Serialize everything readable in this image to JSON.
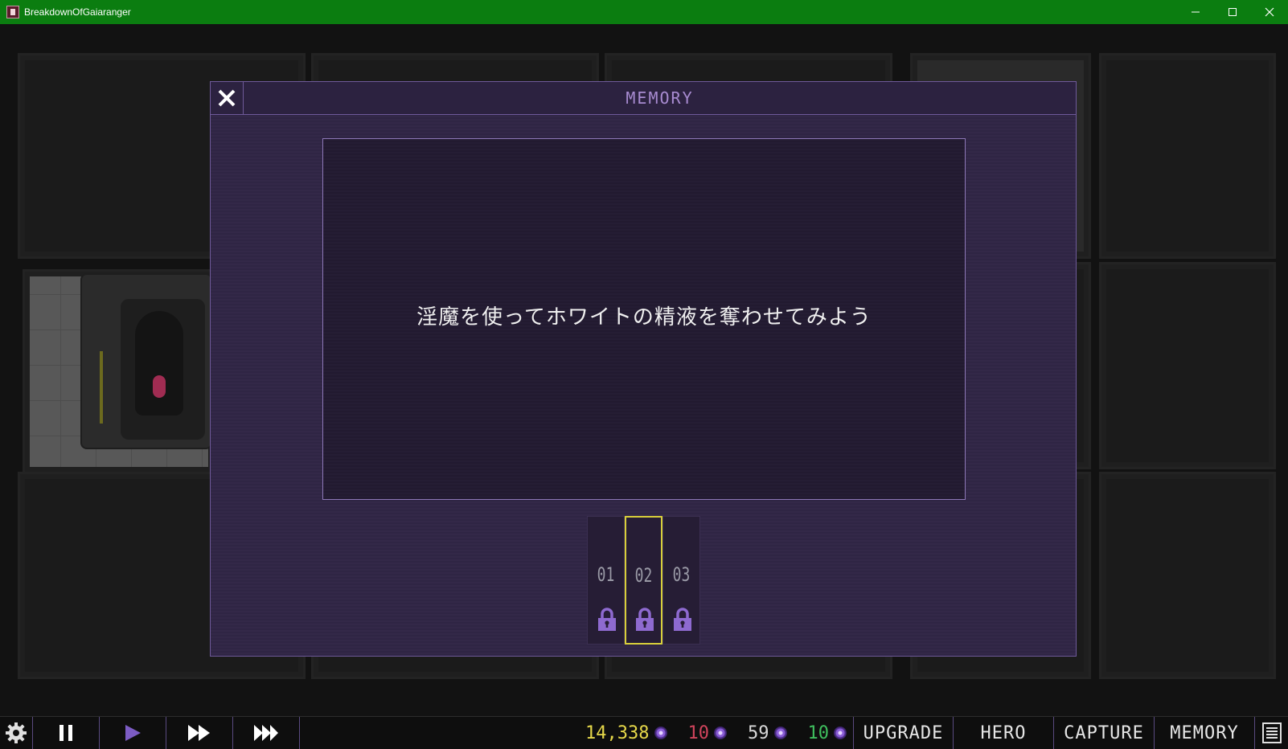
{
  "window": {
    "title": "BreakdownOfGaiaranger",
    "controls": [
      "minimize-icon",
      "maximize-icon",
      "close-icon"
    ],
    "titlebar_color": "#0b7d10"
  },
  "modal": {
    "title": "MEMORY",
    "close_icon": "close-icon",
    "scene_text": "淫魔を使ってホワイトの精液を奪わせてみよう",
    "slots": [
      {
        "label": "01",
        "locked": true,
        "selected": false
      },
      {
        "label": "02",
        "locked": true,
        "selected": true
      },
      {
        "label": "03",
        "locked": true,
        "selected": false
      }
    ]
  },
  "bottombar": {
    "icons": [
      "gear-icon",
      "pause-icon",
      "play-icon",
      "fast-forward-icon",
      "fastest-forward-icon"
    ],
    "active_speed": "play",
    "resources": [
      {
        "value": "14,338",
        "color": "#e6d84a"
      },
      {
        "value": "10",
        "color": "#d0445c"
      },
      {
        "value": "59",
        "color": "#d8d8d8"
      },
      {
        "value": "10",
        "color": "#3fbf5e"
      }
    ],
    "menu": {
      "upgrade": "UPGRADE",
      "hero": "HERO",
      "capture": "CAPTURE",
      "memory": "MEMORY"
    },
    "list_icon": "list-icon"
  },
  "colors": {
    "accent_purple": "#a88bd1",
    "selection_yellow": "#d8cf3a"
  }
}
